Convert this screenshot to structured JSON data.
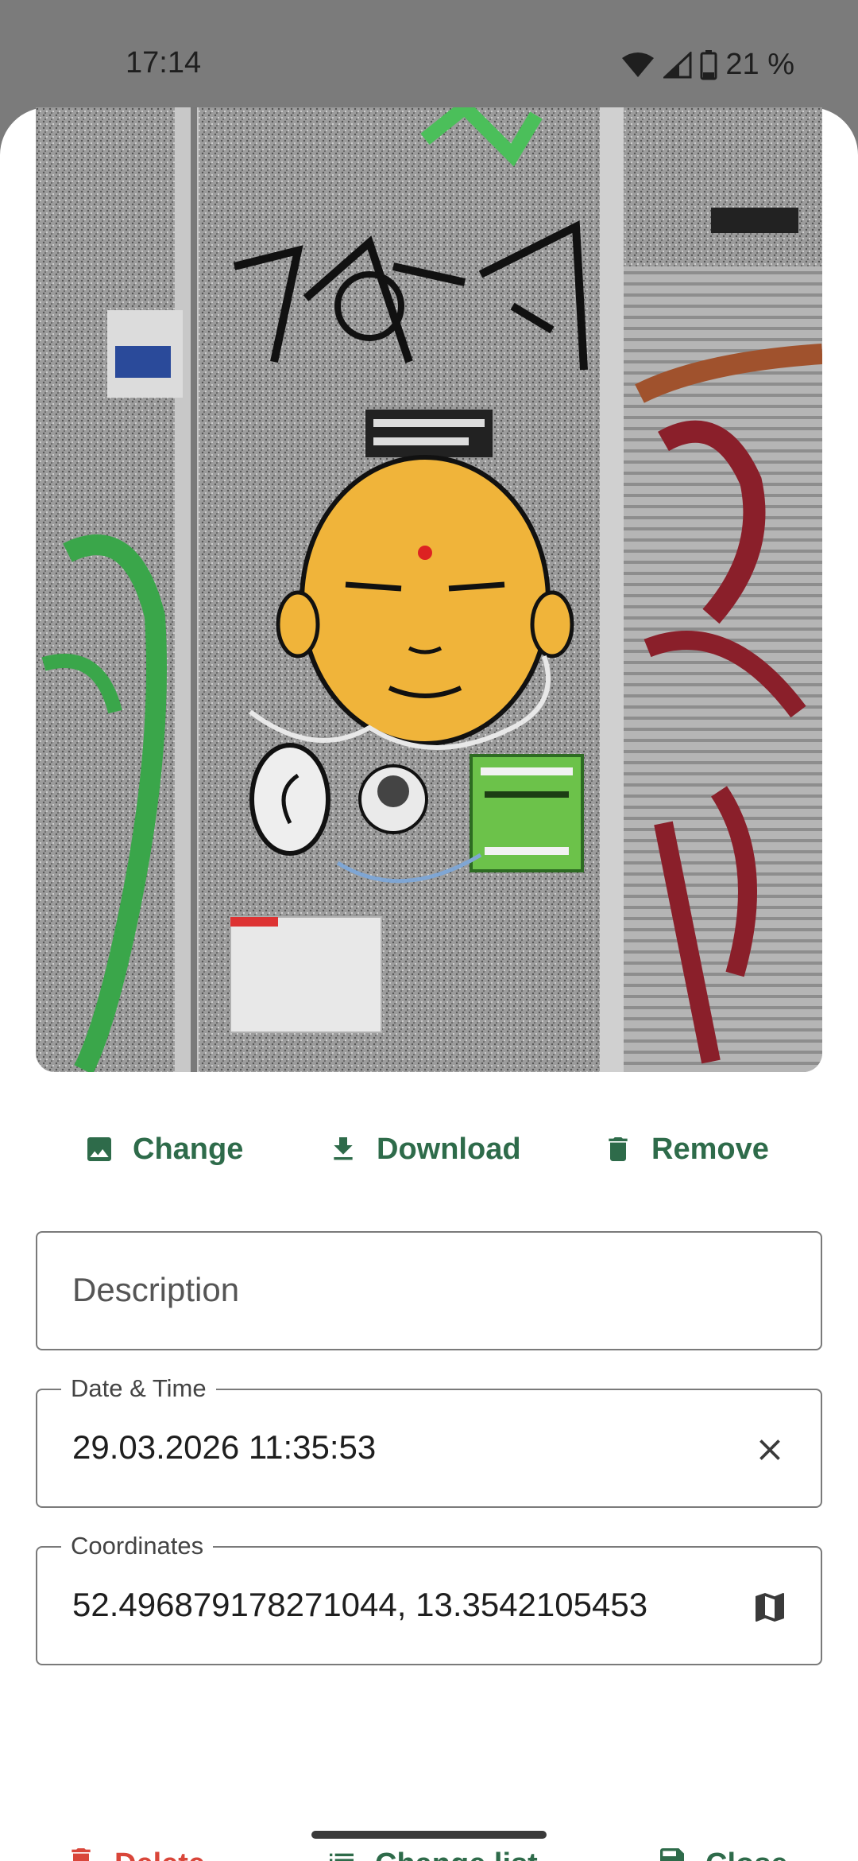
{
  "status_bar": {
    "time": "17:14",
    "battery": "21 %",
    "icons": [
      "wifi-icon",
      "cellular-signal-icon",
      "battery-icon"
    ]
  },
  "image_actions": {
    "change_label": "Change",
    "download_label": "Download",
    "remove_label": "Remove"
  },
  "form": {
    "description": {
      "placeholder": "Description",
      "value": ""
    },
    "date_time": {
      "label": "Date & Time",
      "value": "29.03.2026 11:35:53"
    },
    "coordinates": {
      "label": "Coordinates",
      "value": "52.496879178271044, 13.3542105453"
    }
  },
  "bottom_actions": {
    "delete_label": "Delete",
    "change_list_label": "Change list",
    "close_label": "Close"
  },
  "colors": {
    "accent_green": "#2e6b4a",
    "danger_red": "#d9463a",
    "scrim": "#7b7b7b"
  }
}
